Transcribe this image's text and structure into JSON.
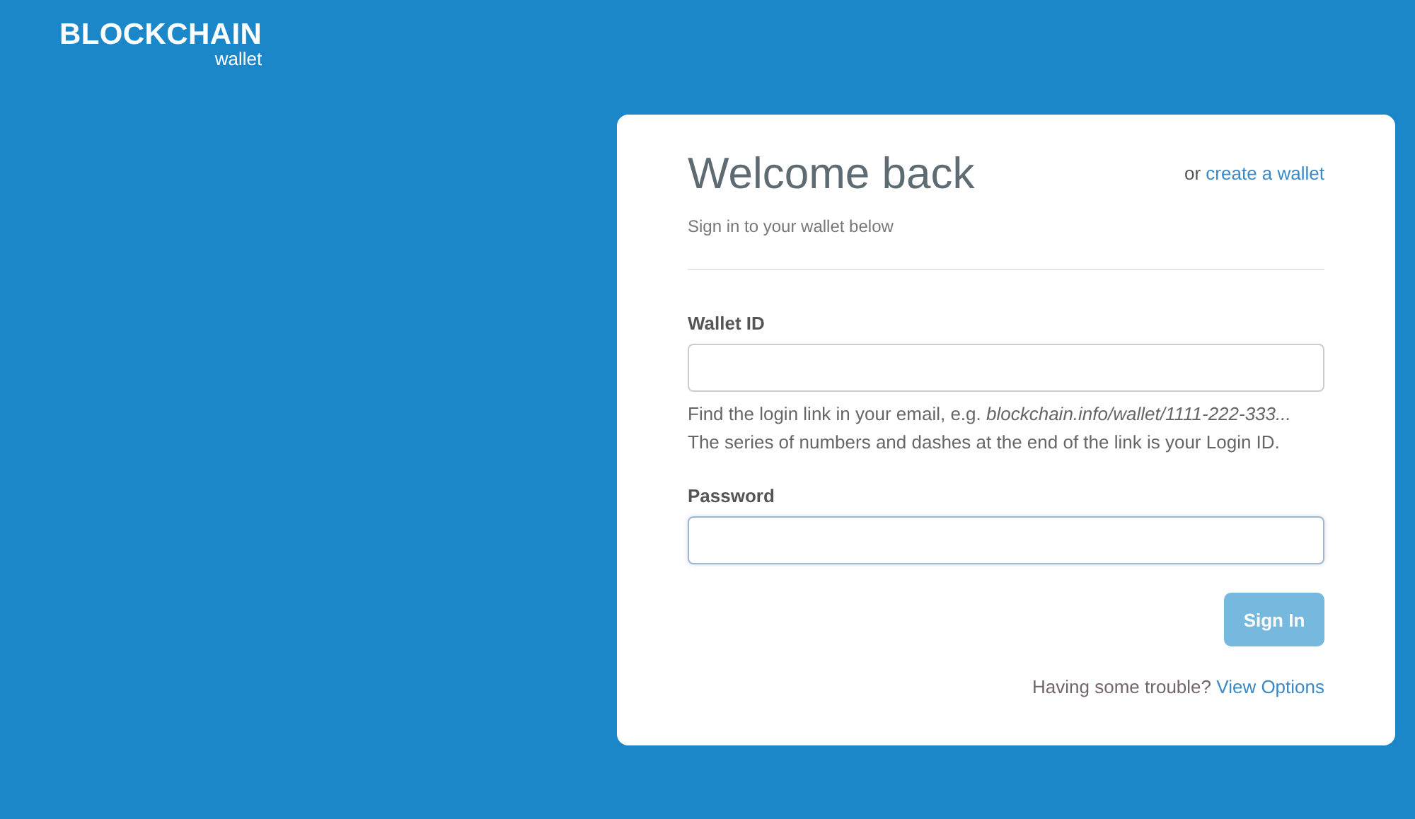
{
  "logo": {
    "title": "BLOCKCHAIN",
    "subtitle": "wallet"
  },
  "card": {
    "title": "Welcome back",
    "subtitle": "Sign in to your wallet below",
    "alt_prefix": "or",
    "alt_link": "create a wallet",
    "fields": [
      {
        "label": "Wallet ID",
        "focused": false,
        "hint": "Find the login link in your email, e.g. *blockchain.info/wallet/1111-222-333...*\nThe series of numbers and dashes at the end of the link is your Login ID."
      },
      {
        "label": "Password",
        "focused": true
      }
    ],
    "button": {
      "label": "Sign In",
      "disabled": true
    },
    "help_text": "Having some trouble?",
    "help_link": "View Options"
  }
}
